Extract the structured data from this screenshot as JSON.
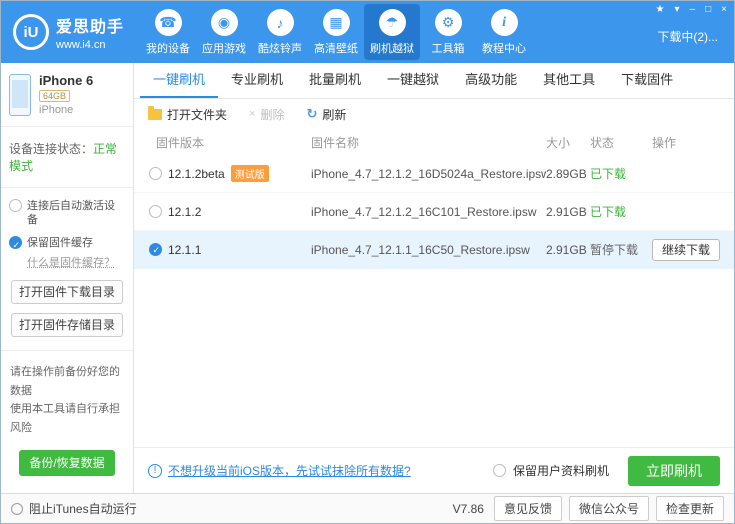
{
  "colors": {
    "header_blue": "#3b96ec",
    "accent_blue": "#2a8ae2",
    "green": "#3cb33c",
    "badge_orange": "#ff9d3d",
    "row_selected_bg": "#e7f3fd"
  },
  "header": {
    "logo": {
      "badge": "iU",
      "title": "爱思助手",
      "url": "www.i4.cn"
    },
    "window_controls": {
      "gift": "★",
      "skin": "▾",
      "minimize": "–",
      "maximize": "□",
      "close": "×"
    },
    "download_status": "下载中(2)...",
    "nav": [
      {
        "label": "我的设备",
        "glyph": "☎"
      },
      {
        "label": "应用游戏",
        "glyph": "◉"
      },
      {
        "label": "酷炫铃声",
        "glyph": "♪"
      },
      {
        "label": "高清壁纸",
        "glyph": "▦"
      },
      {
        "label": "刷机越狱",
        "glyph": "☂",
        "active": true
      },
      {
        "label": "工具箱",
        "glyph": "⚙"
      },
      {
        "label": "教程中心",
        "glyph": "i"
      }
    ]
  },
  "sidebar": {
    "device": {
      "name": "iPhone 6",
      "capacity": "64GB",
      "type": "iPhone"
    },
    "connection": {
      "label": "设备连接状态：",
      "value": "正常模式"
    },
    "auto_activate": "连接后自动激活设备",
    "keep_cache": "保留固件缓存",
    "cache_link": "什么是固件缓存？",
    "open_download_dir": "打开固件下载目录",
    "open_storage_dir": "打开固件存储目录",
    "warning_line1": "请在操作前备份好您的数据",
    "warning_line2": "使用本工具请自行承担风险",
    "backup_button": "备份/恢复数据"
  },
  "main": {
    "tabs": [
      {
        "label": "一键刷机",
        "active": true
      },
      {
        "label": "专业刷机"
      },
      {
        "label": "批量刷机"
      },
      {
        "label": "一键越狱"
      },
      {
        "label": "高级功能"
      },
      {
        "label": "其他工具"
      },
      {
        "label": "下载固件"
      }
    ],
    "toolbar": {
      "open_folder": "打开文件夹",
      "delete_label": "删除",
      "delete_icon": "×",
      "refresh_label": "刷新",
      "refresh_icon": "↻"
    },
    "table": {
      "headers": [
        "固件版本",
        "固件名称",
        "大小",
        "状态",
        "操作"
      ],
      "rows": [
        {
          "version": "12.1.2beta",
          "beta_badge": "测试版",
          "name": "iPhone_4.7_12.1.2_16D5024a_Restore.ipsw",
          "size": "2.89GB",
          "status": "已下载",
          "selected": false
        },
        {
          "version": "12.1.2",
          "name": "iPhone_4.7_12.1.2_16C101_Restore.ipsw",
          "size": "2.91GB",
          "status": "已下载",
          "selected": false
        },
        {
          "version": "12.1.1",
          "name": "iPhone_4.7_12.1.1_16C50_Restore.ipsw",
          "size": "2.91GB",
          "status": "暂停下载",
          "selected": true,
          "action": "继续下载"
        }
      ]
    },
    "footer": {
      "tip_icon": "!",
      "tip_link": "不想升级当前iOS版本，先试试抹除所有数据?",
      "keep_user_data": "保留用户资料刷机",
      "flash_button": "立即刷机"
    }
  },
  "statusbar": {
    "block_itunes": "阻止iTunes自动运行",
    "version": "V7.86",
    "feedback": "意见反馈",
    "wechat": "微信公众号",
    "check_update": "检查更新"
  }
}
